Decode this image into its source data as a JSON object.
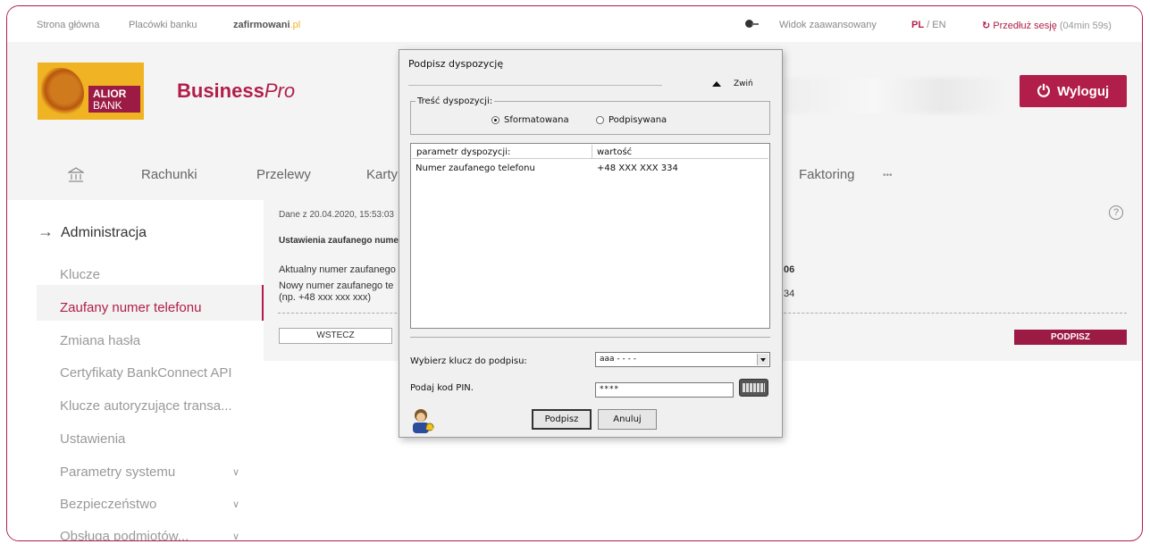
{
  "topbar": {
    "home": "Strona główna",
    "branches": "Placówki banku",
    "brand_main": "zafirmowani",
    "brand_ext": ".pl",
    "advanced_view": "Widok zaawansowany",
    "lang_pl": "PL",
    "lang_sep": " / ",
    "lang_en": "EN",
    "extend_session": "Przedłuż sesję",
    "session_time": "(04min 59s)"
  },
  "header": {
    "logo_line1": "ALIOR",
    "logo_line2": "BANK",
    "product_bold": "Business",
    "product_italic": "Pro",
    "logout_label": "Wyloguj"
  },
  "nav": {
    "items": [
      "Rachunki",
      "Przelewy",
      "Karty",
      "Faktoring",
      "•••"
    ]
  },
  "sidebar": {
    "title": "Administracja",
    "items": [
      "Klucze",
      "Zaufany numer telefonu",
      "Zmiana hasła",
      "Certyfikaty BankConnect API",
      "Klucze autoryzujące transa...",
      "Ustawienia",
      "Parametry systemu",
      "Bezpieczeństwo",
      "Obsługa podmiotów..."
    ],
    "active_index": 1
  },
  "content": {
    "data_date": "Dane z 20.04.2020, 15:53:03",
    "section_title": "Ustawienia zaufanego numer",
    "current_label": "Aktualny numer zaufanego",
    "new_label": "Nowy numer zaufanego te",
    "new_hint": "(np. +48 xxx xxx xxx)",
    "current_value_tail": "06",
    "new_value_tail": "34",
    "back_button": "WSTECZ",
    "sign_button": "PODPISZ"
  },
  "dialog": {
    "title": "Podpisz dyspozycję",
    "collapse_label": "Zwiń",
    "group_label": "Treść dyspozycji:",
    "radio_formatted": "Sformatowana",
    "radio_signed": "Podpisywana",
    "table_headers": [
      "parametr dyspozycji:",
      "wartość"
    ],
    "table_rows": [
      [
        "Numer zaufanego telefonu",
        "+48 XXX XXX 334"
      ]
    ],
    "key_label": "Wybierz klucz do podpisu:",
    "key_value": "aaa - - - -",
    "pin_label": "Podaj kod PIN.",
    "pin_value": "****",
    "ok_button": "Podpisz",
    "cancel_button": "Anuluj"
  }
}
